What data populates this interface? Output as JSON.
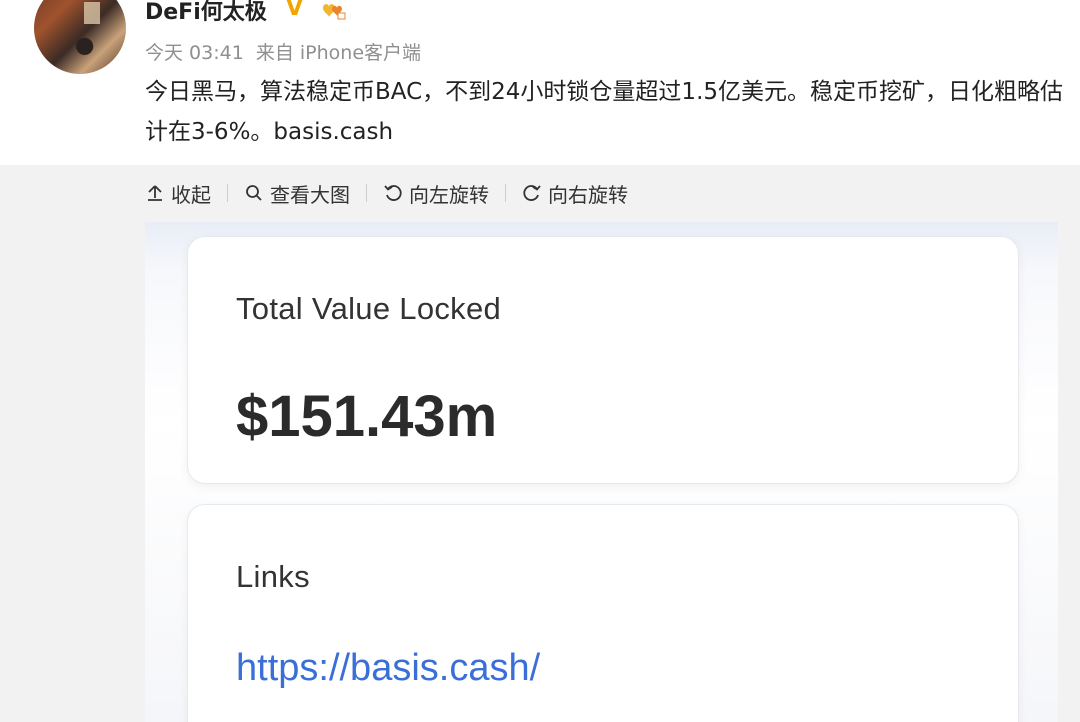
{
  "post": {
    "username": "DeFi何太极",
    "verified_badge": "V",
    "time": "今天 03:41",
    "source": "来自 iPhone客户端",
    "text": "今日黑马，算法稳定币BAC，不到24小时锁仓量超过1.5亿美元。稳定币挖矿，日化粗略估计在3-6%。basis.cash"
  },
  "toolbar": {
    "collapse": "收起",
    "view_large": "查看大图",
    "rotate_left": "向左旋转",
    "rotate_right": "向右旋转"
  },
  "image": {
    "tvl_title": "Total Value Locked",
    "tvl_value": "$151.43m",
    "links_title": "Links",
    "link_url": "https://basis.cash/"
  },
  "colors": {
    "verified": "#f2a400",
    "link": "#3b6fd8",
    "meta_gray": "#8f8f8f"
  },
  "icons": {
    "collapse": "arrow-up-icon",
    "view_large": "search-icon",
    "rotate_left": "rotate-left-icon",
    "rotate_right": "rotate-right-icon"
  }
}
